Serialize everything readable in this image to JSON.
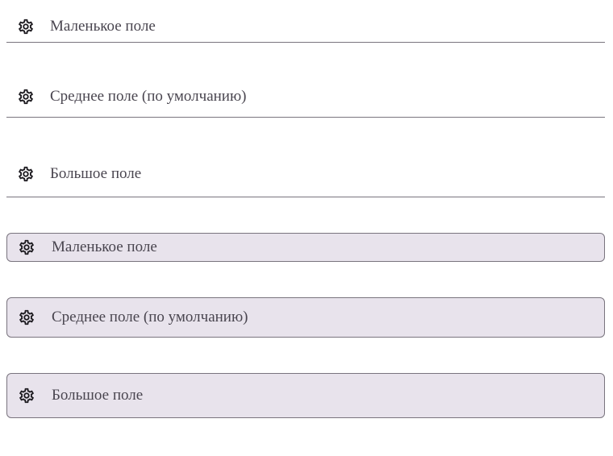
{
  "fields": [
    {
      "variant": "standard",
      "size": "small",
      "icon": "gear-icon",
      "label": "Маленькое поле"
    },
    {
      "variant": "standard",
      "size": "medium",
      "icon": "gear-icon",
      "label": "Среднее поле (по умолчанию)"
    },
    {
      "variant": "standard",
      "size": "large",
      "icon": "gear-icon",
      "label": "Большое поле"
    },
    {
      "variant": "filled",
      "size": "small",
      "icon": "gear-icon",
      "label": "Маленькое поле"
    },
    {
      "variant": "filled",
      "size": "medium",
      "icon": "gear-icon",
      "label": "Среднее поле (по умолчанию)"
    },
    {
      "variant": "filled",
      "size": "large",
      "icon": "gear-icon",
      "label": "Большое поле"
    }
  ],
  "colors": {
    "text": "#49454f",
    "outline": "#79747e",
    "filled_bg": "#e8e3ec",
    "icon": "#1d1b20"
  }
}
